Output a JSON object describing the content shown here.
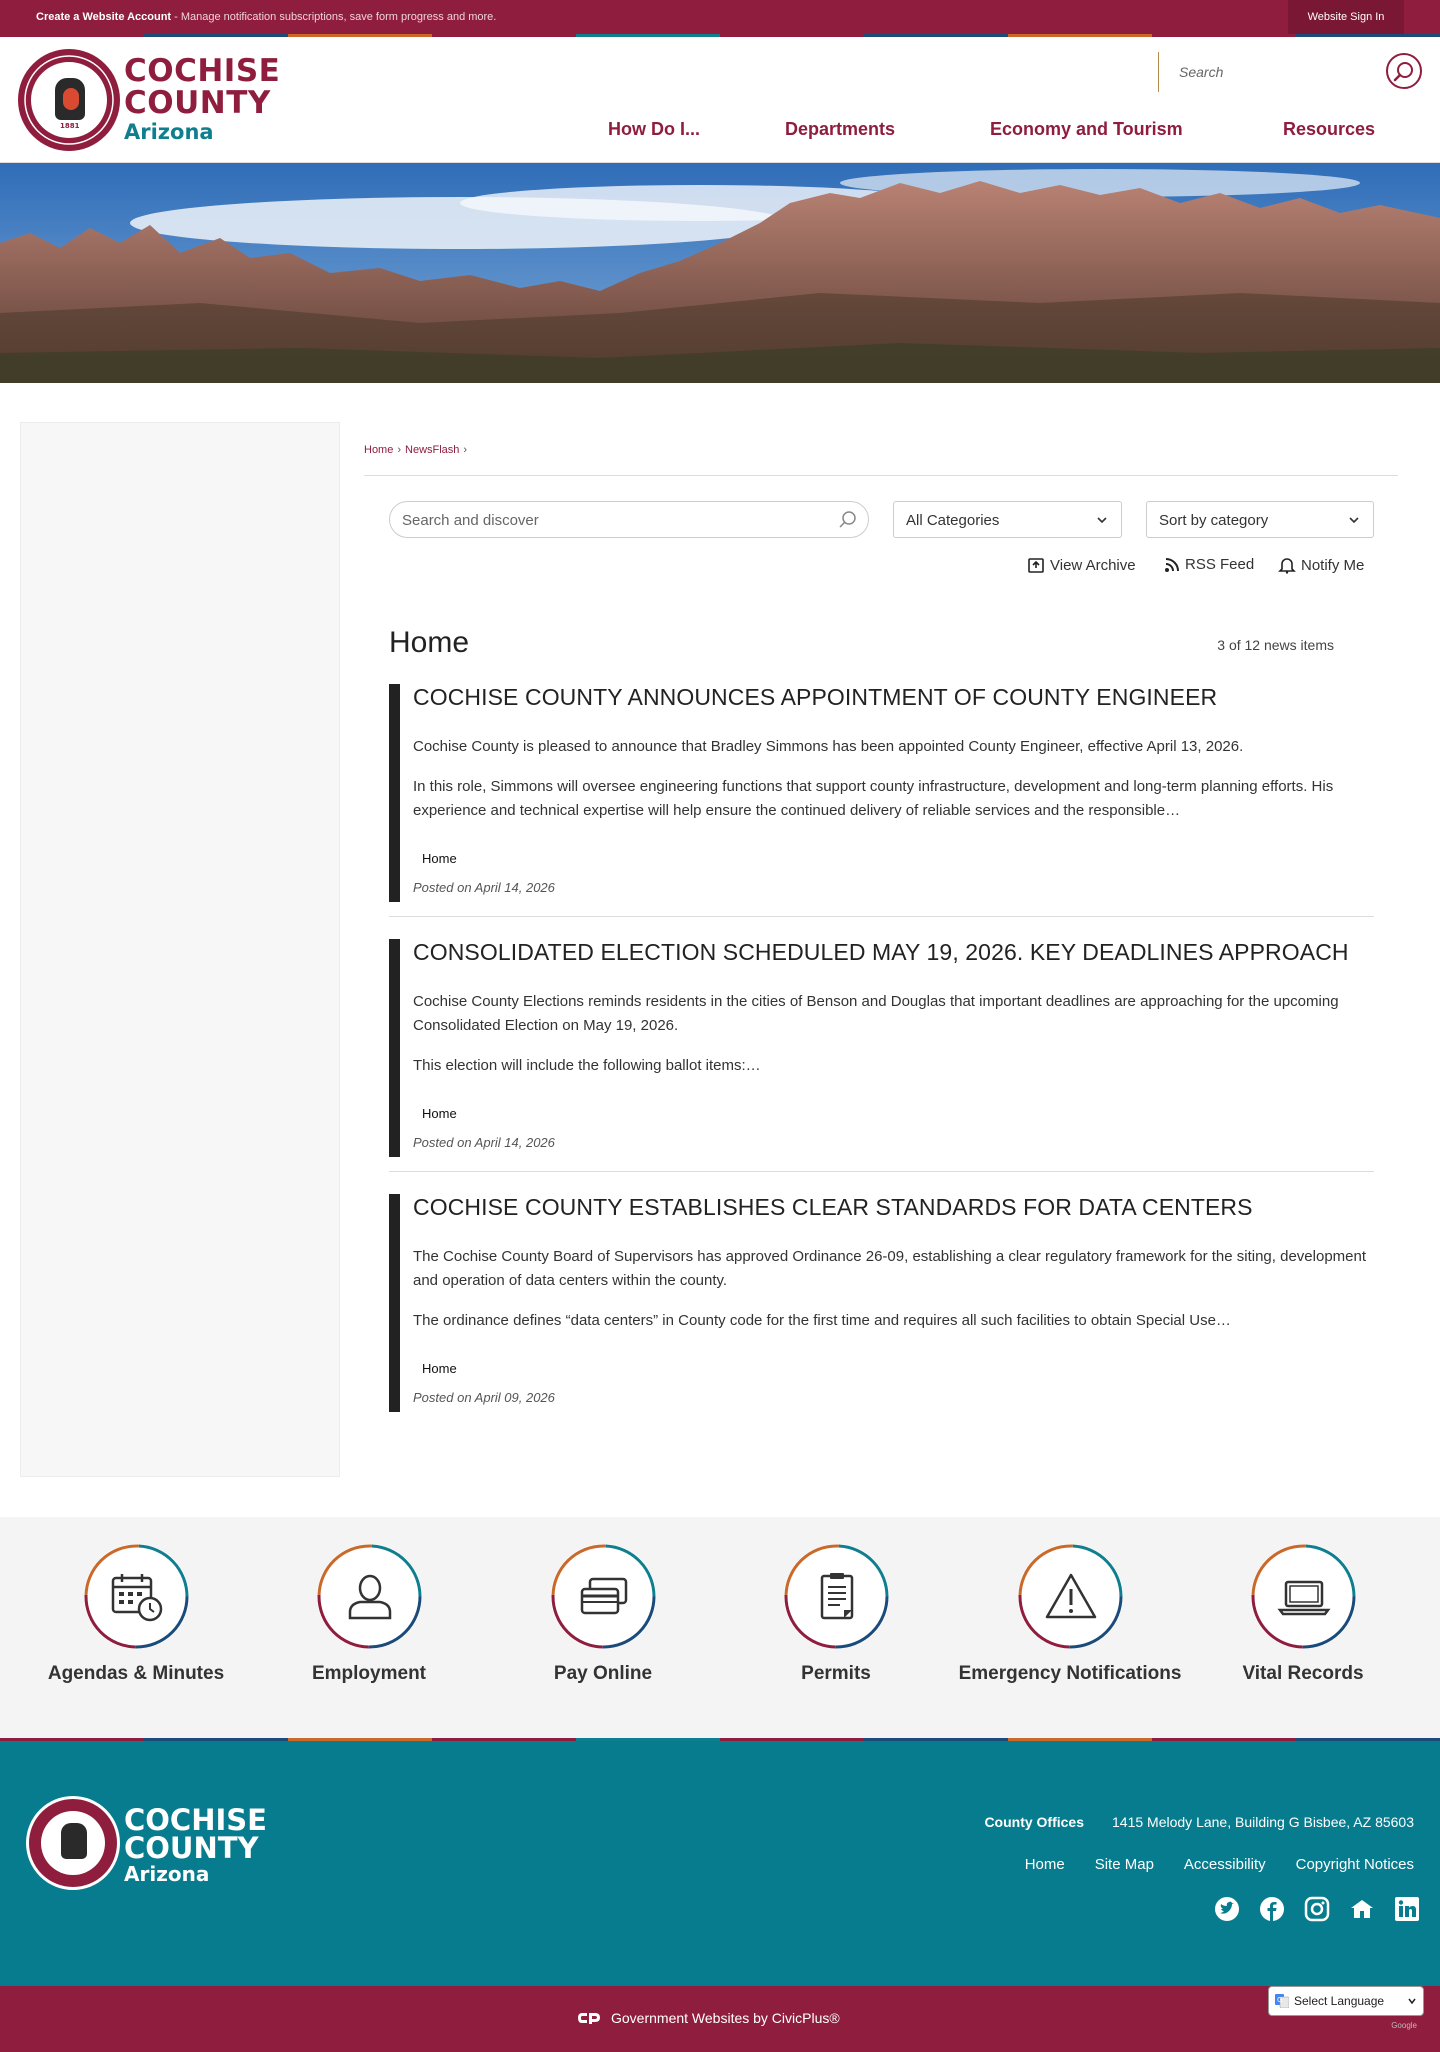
{
  "topbar": {
    "create_account_bold": "Create a Website Account",
    "create_account_rest": " - Manage notification subscriptions, save form progress and more.",
    "sign_in": "Website Sign In",
    "stripe_colors": [
      "#8f1d3e",
      "#1b4b7a",
      "#c96a2b",
      "#8f1d3e",
      "#0f7e8e",
      "#8f1d3e",
      "#1b4b7a",
      "#c96a2b",
      "#8f1d3e",
      "#1b4b7a"
    ]
  },
  "header": {
    "logo_line1": "COCHISE",
    "logo_line2": "COUNTY",
    "logo_line3": "Arizona",
    "seal_year": "1881",
    "search_placeholder": "Search",
    "nav": [
      "How Do I...",
      "Departments",
      "Economy and Tourism",
      "Resources"
    ]
  },
  "breadcrumb": [
    "Home",
    "NewsFlash"
  ],
  "filters": {
    "search_placeholder": "Search and discover",
    "category": "All Categories",
    "sort": "Sort by category",
    "view_archive": "View Archive",
    "rss_feed": "RSS Feed",
    "notify_me": "Notify Me"
  },
  "listing": {
    "title": "Home",
    "count": "3 of 12 news items"
  },
  "news": [
    {
      "title": "COCHISE COUNTY ANNOUNCES APPOINTMENT OF COUNTY ENGINEER",
      "p1": "Cochise County is pleased to announce that Bradley Simmons has been appointed County Engineer, effective April 13, 2026.",
      "p2": "In this role, Simmons will oversee engineering functions that support county infrastructure, development and long-term planning efforts. His experience and technical expertise will help ensure the continued delivery of reliable services and the responsible…",
      "category": "Home",
      "posted": "Posted on April 14, 2026"
    },
    {
      "title": "CONSOLIDATED ELECTION SCHEDULED MAY 19, 2026. KEY DEADLINES APPROACH",
      "p1": "Cochise County Elections reminds residents in the cities of Benson and Douglas that important deadlines are approaching for the upcoming Consolidated Election on May 19, 2026.",
      "p2": "This election will include the following ballot items:…",
      "category": "Home",
      "posted": "Posted on April 14, 2026"
    },
    {
      "title": "COCHISE COUNTY ESTABLISHES CLEAR STANDARDS FOR DATA CENTERS",
      "p1": "The Cochise County Board of Supervisors has approved Ordinance 26-09, establishing a clear regulatory framework for the siting, development and operation of data centers within the county.",
      "p2": "The ordinance defines “data centers” in County code for the first time and requires all such facilities to obtain Special Use…",
      "category": "Home",
      "posted": "Posted on April 09, 2026"
    }
  ],
  "quick_links": [
    {
      "label": "Agendas & Minutes",
      "icon": "calendar-clock-icon"
    },
    {
      "label": "Employment",
      "icon": "person-icon"
    },
    {
      "label": "Pay Online",
      "icon": "credit-card-icon"
    },
    {
      "label": "Permits",
      "icon": "document-icon"
    },
    {
      "label": "Emergency Notifications",
      "icon": "warning-icon"
    },
    {
      "label": "Vital Records",
      "icon": "laptop-icon"
    }
  ],
  "footer": {
    "logo_line1": "COCHISE",
    "logo_line2": "COUNTY",
    "logo_line3": "Arizona",
    "offices_label": "County Offices",
    "address": "1415 Melody Lane, Building G Bisbee, AZ 85603",
    "links": [
      "Home",
      "Site Map",
      "Accessibility",
      "Copyright Notices"
    ],
    "social": [
      "twitter-icon",
      "facebook-icon",
      "instagram-icon",
      "nextdoor-icon",
      "linkedin-icon"
    ],
    "civicplus": "Government Websites by CivicPlus®",
    "language": "Select Language",
    "google_brand": "Google"
  },
  "colors": {
    "brand_maroon": "#8f1d3e",
    "brand_teal": "#067c8e",
    "accent_orange": "#c96a2b",
    "accent_navy": "#1b4b7a"
  }
}
